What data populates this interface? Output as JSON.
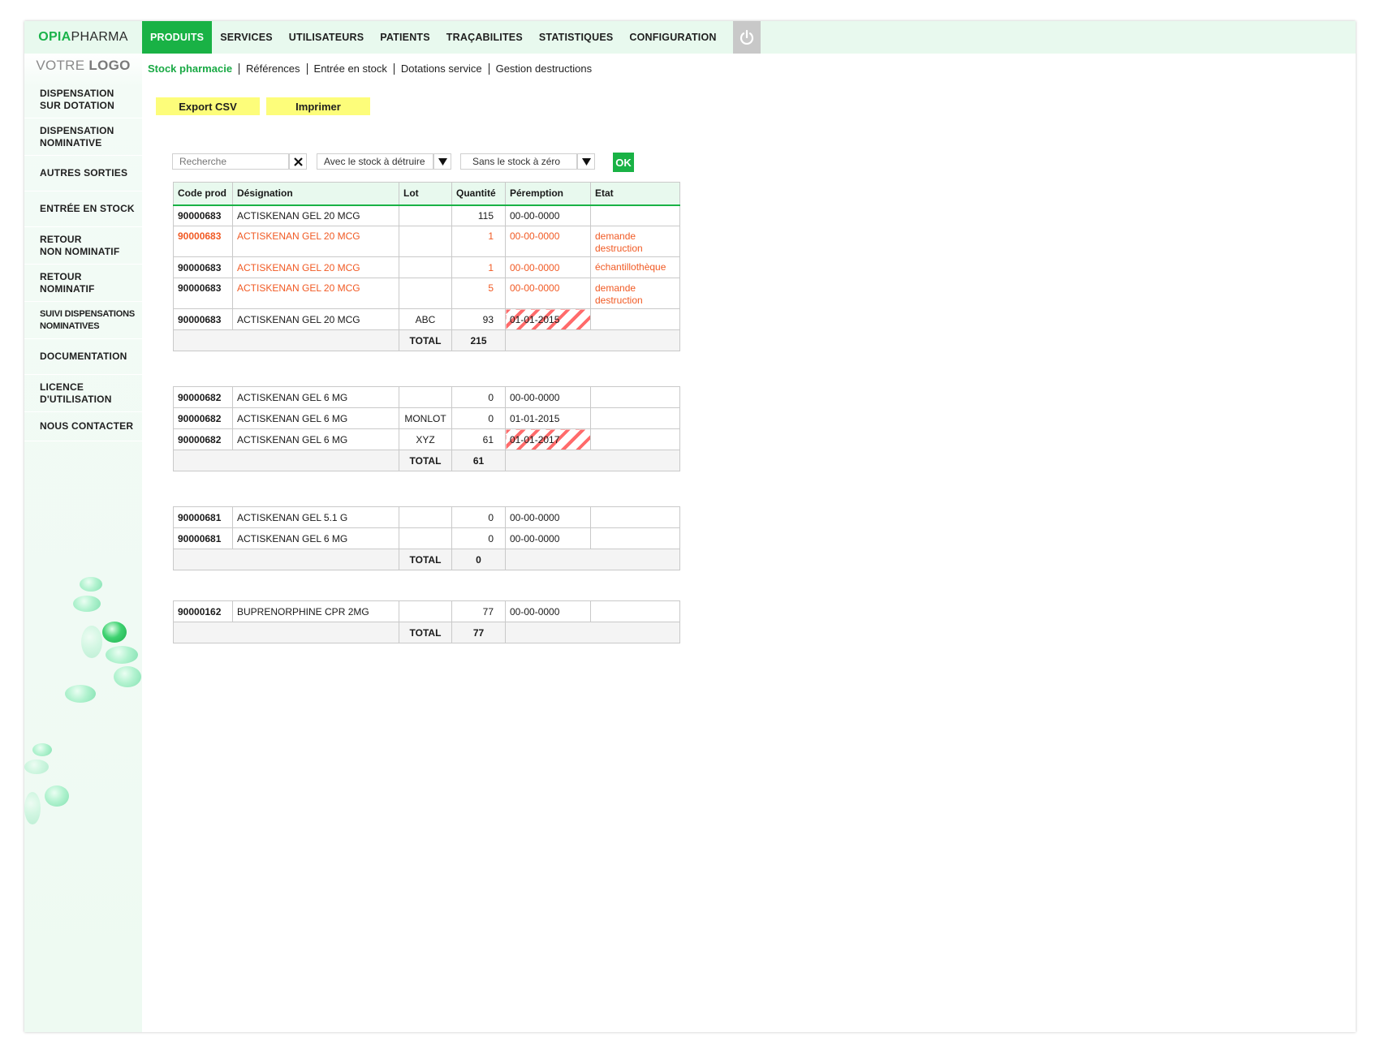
{
  "brand": {
    "part1": "OPIA",
    "part2": "PHARMA"
  },
  "top_nav": [
    {
      "label": "PRODUITS",
      "active": true
    },
    {
      "label": "SERVICES",
      "active": false
    },
    {
      "label": "UTILISATEURS",
      "active": false
    },
    {
      "label": "PATIENTS",
      "active": false
    },
    {
      "label": "TRAÇABILITES",
      "active": false
    },
    {
      "label": "STATISTIQUES",
      "active": false
    },
    {
      "label": "CONFIGURATION",
      "active": false
    }
  ],
  "power_icon": "power-icon",
  "logo": {
    "part1": "VOTRE ",
    "part2": "LOGO"
  },
  "sidebar": {
    "items": [
      {
        "line1": "DISPENSATION",
        "line2": "SUR DOTATION"
      },
      {
        "line1": "DISPENSATION",
        "line2": "NOMINATIVE"
      },
      {
        "line1": "AUTRES SORTIES",
        "line2": ""
      },
      {
        "line1": "ENTRÉE EN STOCK",
        "line2": ""
      },
      {
        "line1": "RETOUR",
        "line2": "NON NOMINATIF"
      },
      {
        "line1": "RETOUR",
        "line2": "NOMINATIF"
      },
      {
        "line1": "SUIVI DISPENSATIONS",
        "line2": "NOMINATIVES"
      },
      {
        "line1": "DOCUMENTATION",
        "line2": ""
      },
      {
        "line1": "LICENCE",
        "line2": "D'UTILISATION"
      },
      {
        "line1": "NOUS CONTACTER",
        "line2": ""
      }
    ]
  },
  "subnav": [
    {
      "label": "Stock pharmacie",
      "active": true
    },
    {
      "label": "Références",
      "active": false
    },
    {
      "label": "Entrée en stock",
      "active": false
    },
    {
      "label": "Dotations service",
      "active": false
    },
    {
      "label": "Gestion destructions",
      "active": false
    }
  ],
  "actions": {
    "export_label": "Export CSV",
    "print_label": "Imprimer"
  },
  "filters": {
    "search_placeholder": "Recherche",
    "select1": "Avec le stock à détruire",
    "select2": "Sans le stock à zéro",
    "ok_label": "OK"
  },
  "colors": {
    "accent": "#19b245",
    "alert": "#f15a24",
    "button_yellow": "#fdfd7a",
    "light_green": "#e8f9ee"
  },
  "table": {
    "headers": [
      "Code prod",
      "Désignation",
      "Lot",
      "Quantité",
      "Péremption",
      "Etat"
    ],
    "total_label": "TOTAL",
    "groups": [
      {
        "rows": [
          {
            "code": "90000683",
            "designation": "ACTISKENAN GEL 20 MCG",
            "lot": "",
            "qty": "115",
            "peremption": "00-00-0000",
            "etat": "",
            "style": "normal",
            "expired": false
          },
          {
            "code": "90000683",
            "designation": "ACTISKENAN GEL 20 MCG",
            "lot": "",
            "qty": "1",
            "peremption": "00-00-0000",
            "etat": "demande destruction",
            "style": "red",
            "expired": false
          },
          {
            "code": "90000683",
            "designation": "ACTISKENAN GEL 20 MCG",
            "lot": "",
            "qty": "1",
            "peremption": "00-00-0000",
            "etat": "échantillothèque",
            "style": "red-code-black",
            "expired": false
          },
          {
            "code": "90000683",
            "designation": "ACTISKENAN GEL 20 MCG",
            "lot": "",
            "qty": "5",
            "peremption": "00-00-0000",
            "etat": "demande destruction",
            "style": "red-code-black",
            "expired": false
          },
          {
            "code": "90000683",
            "designation": "ACTISKENAN GEL 20 MCG",
            "lot": "ABC",
            "qty": "93",
            "peremption": "01-01-2015",
            "etat": "",
            "style": "normal",
            "expired": true
          }
        ],
        "total": "215"
      },
      {
        "rows": [
          {
            "code": "90000682",
            "designation": "ACTISKENAN GEL 6 MG",
            "lot": "",
            "qty": "0",
            "peremption": "00-00-0000",
            "etat": "",
            "style": "normal",
            "expired": false
          },
          {
            "code": "90000682",
            "designation": "ACTISKENAN GEL 6 MG",
            "lot": "MONLOT",
            "qty": "0",
            "peremption": "01-01-2015",
            "etat": "",
            "style": "normal",
            "expired": false
          },
          {
            "code": "90000682",
            "designation": "ACTISKENAN GEL 6 MG",
            "lot": "XYZ",
            "qty": "61",
            "peremption": "01-01-2017",
            "etat": "",
            "style": "normal",
            "expired": true
          }
        ],
        "total": "61"
      },
      {
        "rows": [
          {
            "code": "90000681",
            "designation": "ACTISKENAN GEL 5.1 G",
            "lot": "",
            "qty": "0",
            "peremption": "00-00-0000",
            "etat": "",
            "style": "normal",
            "expired": false
          },
          {
            "code": "90000681",
            "designation": "ACTISKENAN GEL 6 MG",
            "lot": "",
            "qty": "0",
            "peremption": "00-00-0000",
            "etat": "",
            "style": "normal",
            "expired": false
          }
        ],
        "total": "0"
      },
      {
        "rows": [
          {
            "code": "90000162",
            "designation": "BUPRENORPHINE CPR 2MG",
            "lot": "",
            "qty": "77",
            "peremption": "00-00-0000",
            "etat": "",
            "style": "normal",
            "expired": false
          }
        ],
        "total": "77"
      }
    ]
  }
}
